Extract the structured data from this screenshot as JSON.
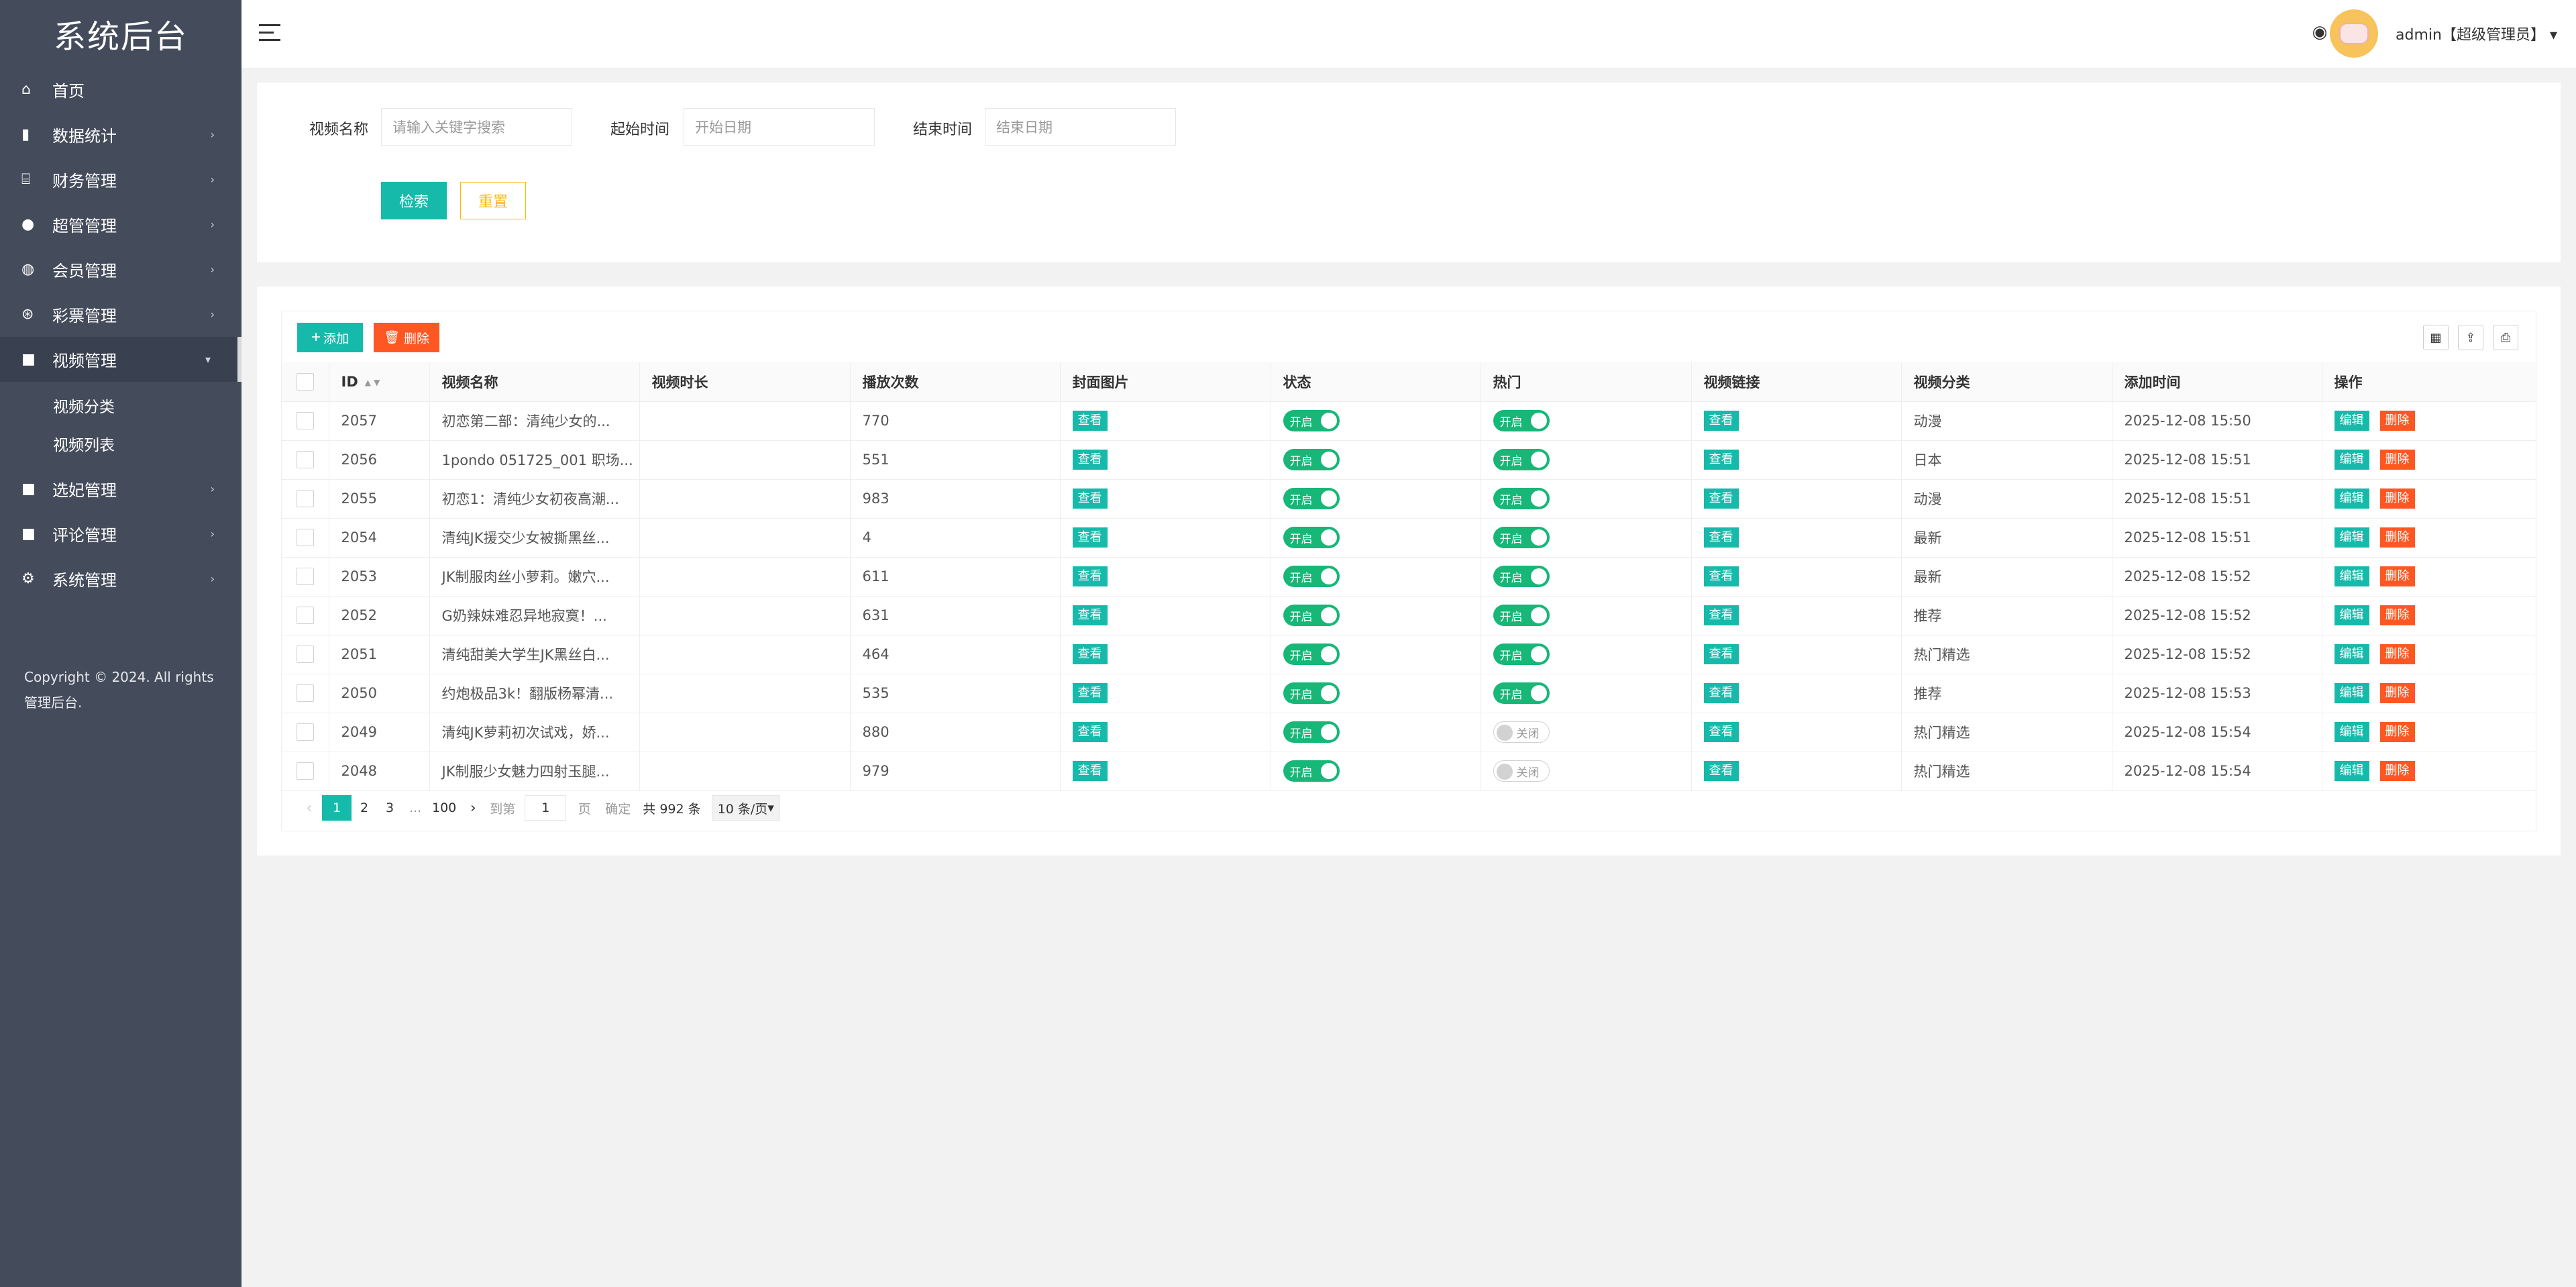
{
  "app": {
    "title": "系统后台"
  },
  "sidebar": {
    "items": [
      {
        "label": "首页",
        "icon": "home-icon",
        "has_caret": false
      },
      {
        "label": "数据统计",
        "icon": "bar-chart-icon",
        "has_caret": true
      },
      {
        "label": "财务管理",
        "icon": "bank-icon",
        "has_caret": true
      },
      {
        "label": "超管管理",
        "icon": "user-icon",
        "has_caret": true
      },
      {
        "label": "会员管理",
        "icon": "users-icon",
        "has_caret": true
      },
      {
        "label": "彩票管理",
        "icon": "gamepad-icon",
        "has_caret": true
      },
      {
        "label": "视频管理",
        "icon": "video-icon",
        "has_caret": true,
        "active": true
      }
    ],
    "subitems": [
      "视频分类",
      "视频列表"
    ],
    "items_after": [
      {
        "label": "选妃管理",
        "icon": "video-icon"
      },
      {
        "label": "评论管理",
        "icon": "video-icon"
      },
      {
        "label": "系统管理",
        "icon": "gear-icon"
      }
    ],
    "copyright": "Copyright © 2024. All rights 管理后台."
  },
  "header": {
    "user": "admin【超级管理员】",
    "user_caret": "▾"
  },
  "search": {
    "name_label": "视频名称",
    "name_placeholder": "请输入关键字搜索",
    "start_label": "起始时间",
    "start_placeholder": "开始日期",
    "end_label": "结束时间",
    "end_placeholder": "结束日期",
    "search_btn": "检索",
    "reset_btn": "重置"
  },
  "toolbar": {
    "add": "添加",
    "delete": "删除"
  },
  "table": {
    "columns": [
      "ID",
      "视频名称",
      "视频时长",
      "播放次数",
      "封面图片",
      "状态",
      "热门",
      "视频链接",
      "视频分类",
      "添加时间",
      "操作"
    ],
    "view_label": "查看",
    "on_label": "开启",
    "off_label": "关闭",
    "edit_label": "编辑",
    "del_label": "删除",
    "rows": [
      {
        "id": "2057",
        "name": "初恋第二部：清纯少女的...",
        "duration": "",
        "plays": "770",
        "hot": true,
        "category": "动漫",
        "time": "2025-12-08 15:50"
      },
      {
        "id": "2056",
        "name": "1pondo 051725_001 职场...",
        "duration": "",
        "plays": "551",
        "hot": true,
        "category": "日本",
        "time": "2025-12-08 15:51"
      },
      {
        "id": "2055",
        "name": "初恋1：清纯少女初夜高潮...",
        "duration": "",
        "plays": "983",
        "hot": true,
        "category": "动漫",
        "time": "2025-12-08 15:51"
      },
      {
        "id": "2054",
        "name": "清纯JK援交少女被撕黑丝...",
        "duration": "",
        "plays": "4",
        "hot": true,
        "category": "最新",
        "time": "2025-12-08 15:51"
      },
      {
        "id": "2053",
        "name": "JK制服肉丝小萝莉。嫩穴...",
        "duration": "",
        "plays": "611",
        "hot": true,
        "category": "最新",
        "time": "2025-12-08 15:52"
      },
      {
        "id": "2052",
        "name": "G奶辣妹难忍异地寂寞！...",
        "duration": "",
        "plays": "631",
        "hot": true,
        "category": "推荐",
        "time": "2025-12-08 15:52"
      },
      {
        "id": "2051",
        "name": "清纯甜美大学生JK黑丝白...",
        "duration": "",
        "plays": "464",
        "hot": true,
        "category": "热门精选",
        "time": "2025-12-08 15:52"
      },
      {
        "id": "2050",
        "name": "约炮极品3k！翻版杨幂清...",
        "duration": "",
        "plays": "535",
        "hot": true,
        "category": "推荐",
        "time": "2025-12-08 15:53"
      },
      {
        "id": "2049",
        "name": "清纯JK萝莉初次试戏，娇...",
        "duration": "",
        "plays": "880",
        "hot": false,
        "category": "热门精选",
        "time": "2025-12-08 15:54"
      },
      {
        "id": "2048",
        "name": "JK制服少女魅力四射玉腿...",
        "duration": "",
        "plays": "979",
        "hot": false,
        "category": "热门精选",
        "time": "2025-12-08 15:54"
      }
    ]
  },
  "pagination": {
    "pages": [
      "1",
      "2",
      "3"
    ],
    "ellipsis": "...",
    "last": "100",
    "goto_label": "到第",
    "goto_value": "1",
    "page_unit": "页",
    "confirm": "确定",
    "total": "共 992 条",
    "per_page": "10 条/页"
  },
  "colors": {
    "sidebar": "#444c5c",
    "primary": "#16baaa",
    "danger": "#ff5722",
    "warning": "#ffb800",
    "switch_on": "#16b777"
  }
}
